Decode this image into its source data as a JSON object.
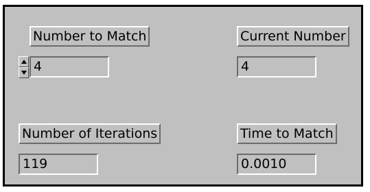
{
  "number_to_match": {
    "label": "Number to Match",
    "value": "4"
  },
  "current_number": {
    "label": "Current Number",
    "value": "4"
  },
  "number_of_iterations": {
    "label": "Number of Iterations",
    "value": "119"
  },
  "time_to_match": {
    "label": "Time to Match",
    "value": "0.0010"
  },
  "icons": {
    "increment": "triangle-up-icon",
    "decrement": "triangle-down-icon"
  },
  "colors": {
    "panel_background": "#c0c0c0",
    "panel_border": "#000000",
    "bevel_light": "#ffffff",
    "bevel_dark": "#6b6b6b",
    "text": "#000000"
  }
}
